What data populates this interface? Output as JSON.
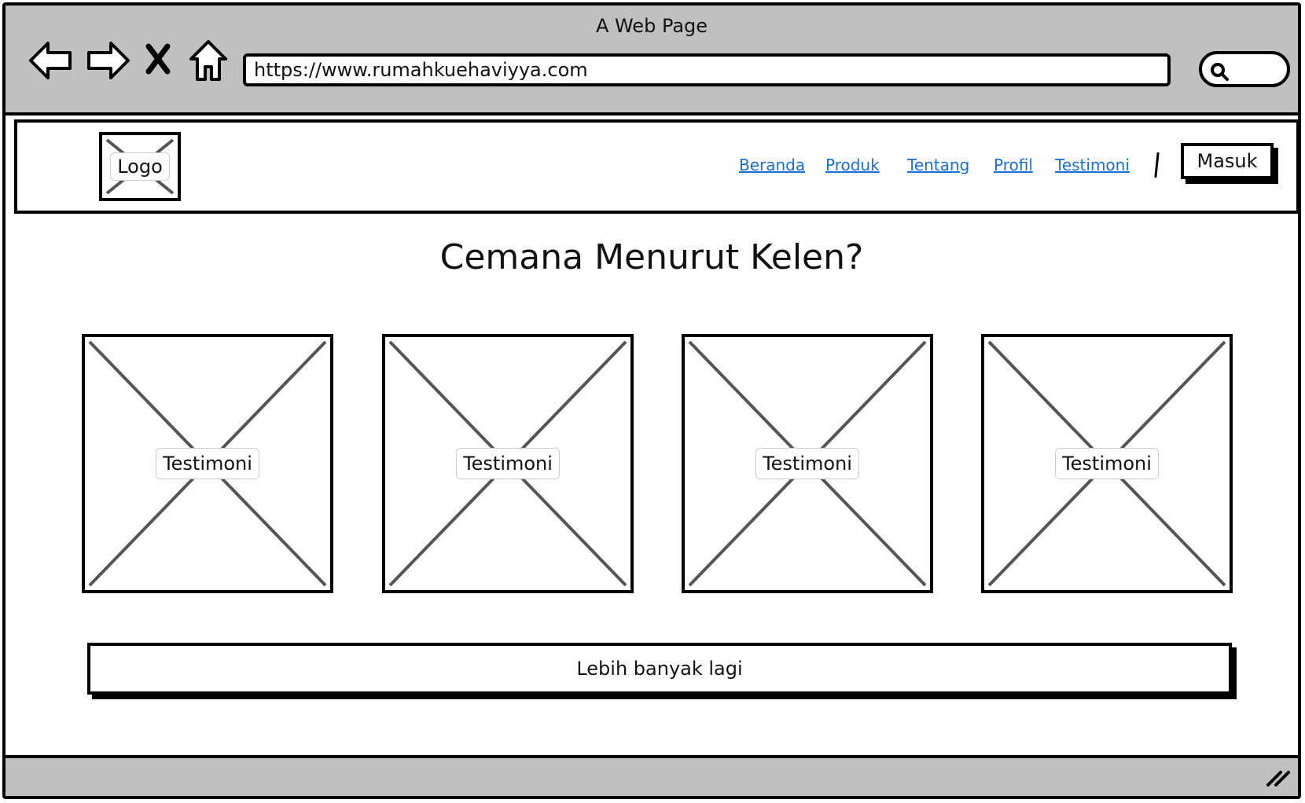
{
  "window": {
    "title": "A Web Page"
  },
  "browser": {
    "url": "https://www.rumahkuehaviyya.com",
    "icons": [
      "back-arrow-icon",
      "forward-arrow-icon",
      "close-x-icon",
      "home-icon",
      "search-icon",
      "resize-grip-icon"
    ]
  },
  "header": {
    "logo_label": "Logo",
    "nav": [
      "Beranda",
      "Produk",
      "Tentang",
      "Profil",
      "Testimoni"
    ],
    "login_label": "Masuk",
    "link_color": "#1a6fd6"
  },
  "main": {
    "title": "Cemana Menurut Kelen?",
    "cards": [
      {
        "label": "Testimoni"
      },
      {
        "label": "Testimoni"
      },
      {
        "label": "Testimoni"
      },
      {
        "label": "Testimoni"
      }
    ],
    "more_label": "Lebih banyak lagi"
  },
  "colors": {
    "chrome": "#c0c0c0",
    "border": "#000000",
    "placeholder_x": "#555555"
  }
}
